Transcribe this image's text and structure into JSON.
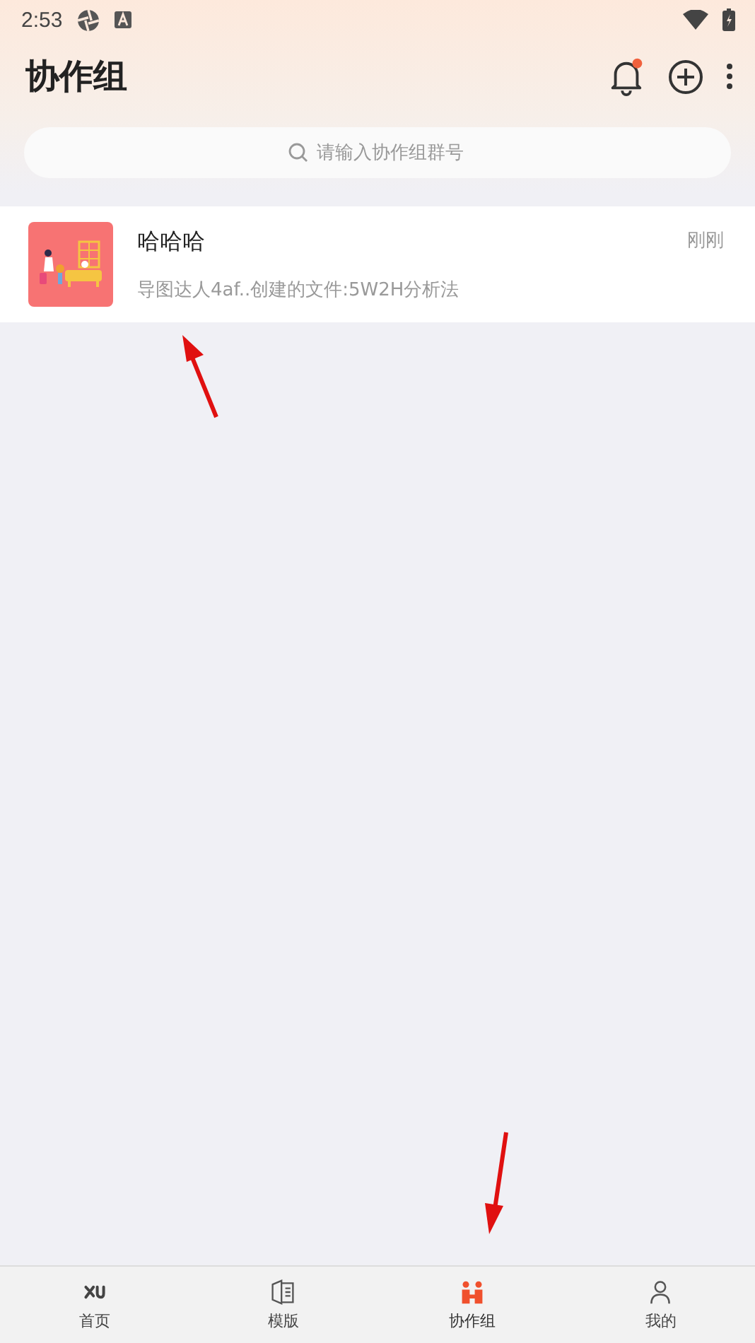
{
  "status_bar": {
    "time": "2:53"
  },
  "header": {
    "title": "协作组",
    "notification_unread": true
  },
  "search": {
    "placeholder": "请输入协作组群号"
  },
  "groups": [
    {
      "name": "哈哈哈",
      "time": "刚刚",
      "last_message": "导图达人4af..创建的文件:5W2H分析法",
      "kind": "picture"
    }
  ],
  "tabs": [
    {
      "label": "首页",
      "selected": false,
      "kind": "home"
    },
    {
      "label": "模版",
      "selected": false,
      "kind": "book"
    },
    {
      "label": "协作组",
      "selected": true,
      "kind": "group"
    },
    {
      "label": "我的",
      "selected": false,
      "kind": "user"
    }
  ]
}
